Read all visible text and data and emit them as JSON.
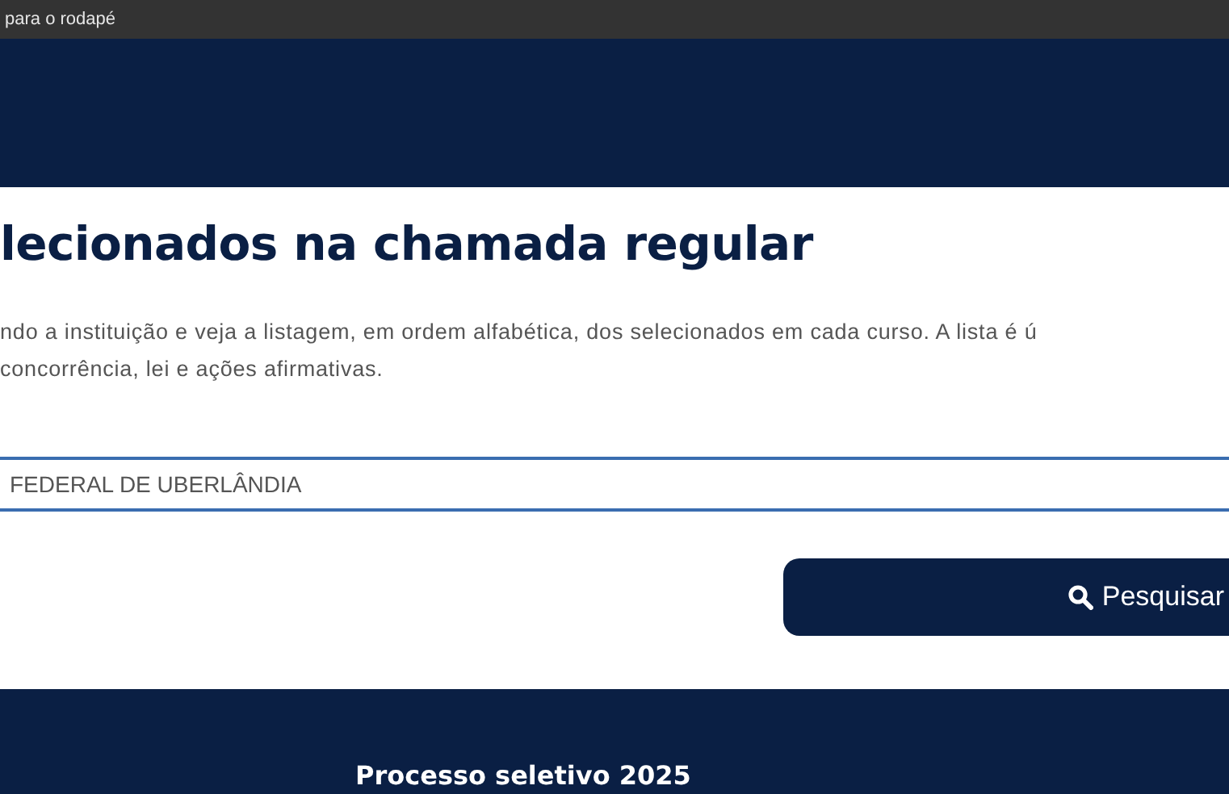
{
  "top_bar": {
    "link": "para o rodapé"
  },
  "section": {
    "title": "lecionados na chamada regular",
    "description": "ndo a instituição e veja a listagem, em ordem alfabética, dos selecionados em cada curso. A lista é ú\nconcorrência, lei e ações afirmativas."
  },
  "institution_field": {
    "value": "FEDERAL DE UBERLÂNDIA"
  },
  "search_button": {
    "label": "Pesquisar"
  },
  "footer": {
    "title": "Processo seletivo 2025"
  }
}
